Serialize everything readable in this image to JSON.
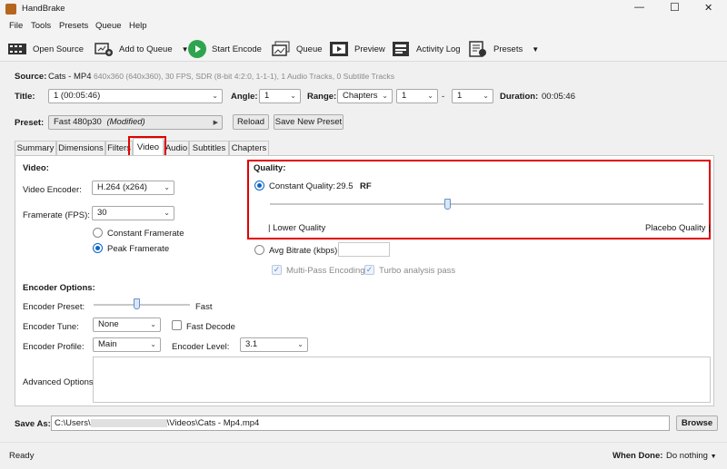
{
  "app": {
    "title": "HandBrake"
  },
  "window_controls": {
    "minimize": "—",
    "maximize": "☐",
    "close": "✕"
  },
  "menu": [
    "File",
    "Tools",
    "Presets",
    "Queue",
    "Help"
  ],
  "toolbar": {
    "open_source": "Open Source",
    "add_to_queue": "Add to Queue",
    "start_encode": "Start Encode",
    "queue": "Queue",
    "preview": "Preview",
    "activity_log": "Activity Log",
    "presets": "Presets"
  },
  "source": {
    "label": "Source:",
    "name": "Cats - MP4",
    "info": "640x360 (640x360), 30 FPS, SDR (8-bit 4:2:0, 1-1-1), 1 Audio Tracks, 0 Subtitle Tracks"
  },
  "title_row": {
    "title_label": "Title:",
    "title_value": "1  (00:05:46)",
    "angle_label": "Angle:",
    "angle_value": "1",
    "range_label": "Range:",
    "range_value": "Chapters",
    "range_start": "1",
    "range_sep": "-",
    "range_end": "1",
    "duration_label": "Duration:",
    "duration_value": "00:05:46"
  },
  "preset_row": {
    "label": "Preset:",
    "value": "Fast 480p30",
    "modified": "(Modified)",
    "reload": "Reload",
    "save_new": "Save New Preset"
  },
  "tabs": [
    "Summary",
    "Dimensions",
    "Filters",
    "Video",
    "Audio",
    "Subtitles",
    "Chapters"
  ],
  "active_tab": "Video",
  "video": {
    "heading": "Video:",
    "encoder_label": "Video Encoder:",
    "encoder_value": "H.264 (x264)",
    "framerate_label": "Framerate (FPS):",
    "framerate_value": "30",
    "constant_framerate": "Constant Framerate",
    "peak_framerate": "Peak Framerate"
  },
  "quality": {
    "heading": "Quality:",
    "cq_label": "Constant Quality:",
    "cq_value": "29.5",
    "cq_unit": "RF",
    "slider_level": 0.41,
    "lower": "| Lower Quality",
    "placebo": "Placebo Quality |",
    "avg_bitrate": "Avg Bitrate (kbps):",
    "multipass": "Multi-Pass Encoding",
    "turbo": "Turbo analysis pass"
  },
  "encoder_options": {
    "heading": "Encoder Options:",
    "preset_label": "Encoder Preset:",
    "preset_value": "Fast",
    "preset_level": 0.45,
    "tune_label": "Encoder Tune:",
    "tune_value": "None",
    "fast_decode": "Fast Decode",
    "profile_label": "Encoder Profile:",
    "profile_value": "Main",
    "level_label": "Encoder Level:",
    "level_value": "3.1",
    "advanced_label": "Advanced Options:"
  },
  "save_as": {
    "label": "Save As:",
    "path_prefix": "C:\\Users\\",
    "path_suffix": "\\Videos\\Cats - Mp4.mp4",
    "browse": "Browse"
  },
  "status": {
    "ready": "Ready",
    "when_done_label": "When Done:",
    "when_done_value": "Do nothing"
  }
}
